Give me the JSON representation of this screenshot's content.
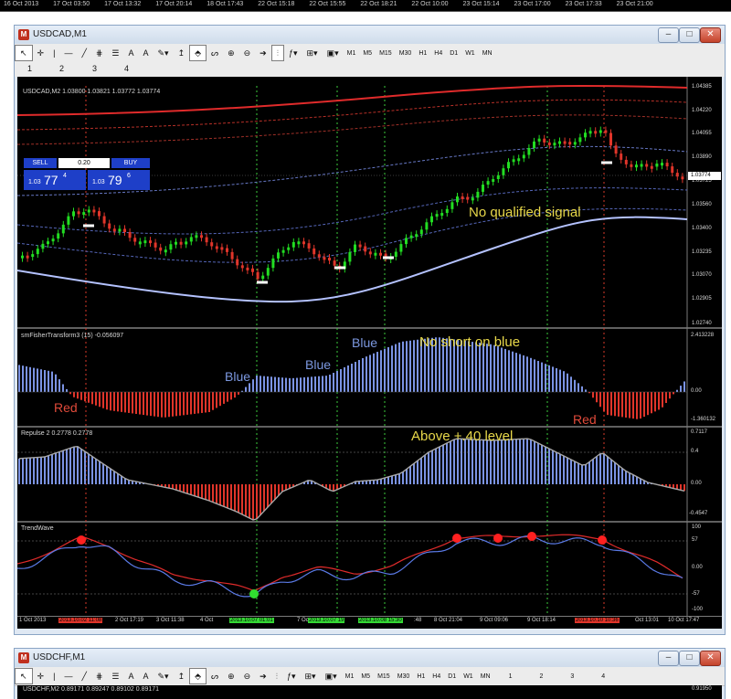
{
  "top_strip": {
    "time_labels": [
      "16 Oct 2013",
      "17 Oct 03:50",
      "17 Oct 13:32",
      "17 Oct 20:14",
      "18 Oct 17:43",
      "22 Oct 15:18",
      "22 Oct 15:55",
      "22 Oct 18:21",
      "22 Oct 10:00",
      "23 Oct 15:14",
      "23 Oct 17:00",
      "23 Oct 17:33",
      "23 Oct 21:00"
    ]
  },
  "windows": [
    {
      "title": "USDCAD,M1",
      "controls": {
        "minimize": "–",
        "maximize": "□",
        "close": "✕"
      },
      "toolbar_letters": [
        "A",
        "A"
      ],
      "timeframes": [
        "M1",
        "M5",
        "M15",
        "M30",
        "H1",
        "H4",
        "D1",
        "W1",
        "MN"
      ],
      "chart_numbers": [
        "1",
        "2",
        "3",
        "4"
      ]
    },
    {
      "title": "USDCHF,M1",
      "controls": {
        "minimize": "–",
        "maximize": "□",
        "close": "✕"
      },
      "toolbar_letters": [
        "A",
        "A"
      ],
      "timeframes": [
        "M1",
        "M5",
        "M15",
        "M30",
        "H1",
        "H4",
        "D1",
        "W1",
        "MN"
      ],
      "chart_numbers": [
        "1",
        "2",
        "3",
        "4"
      ]
    }
  ],
  "usdcad_chart": {
    "header": "USDCAD,M2  1.03800 1.03821 1.03772 1.03774",
    "trade_panel": {
      "sell": "SELL",
      "buy": "BUY",
      "lot": "0.20",
      "bid_big": "1.03",
      "bid_main": "77",
      "bid_sup": "4",
      "ask_big": "1.03",
      "ask_main": "79",
      "ask_sup": "6"
    },
    "price_axis": [
      "1.04385",
      "1.04220",
      "1.04055",
      "1.03890",
      "1.03725",
      "1.03560",
      "1.03400",
      "1.03235",
      "1.03070",
      "1.02905",
      "1.02740"
    ],
    "current_price": "1.03774",
    "annotation": "No qualified signal"
  },
  "fisher_panel": {
    "label": "smFisherTransform3 (15) -0.056097",
    "axis": [
      "2.413228",
      "0.00",
      "-1.360132"
    ],
    "annotations": [
      "Blue",
      "Blue",
      "Blue",
      "No short on blue",
      "Red",
      "Red"
    ]
  },
  "repulse_panel": {
    "label": "Repulse 2 0.2778 0.2778",
    "axis": [
      "0.7117",
      "0.4",
      "0.00",
      "-0.4547"
    ],
    "annotation": "Above +.40 level"
  },
  "trendwave_panel": {
    "label": "TrendWave",
    "axis": [
      "100",
      "57",
      "0.00",
      "-57",
      "-100"
    ]
  },
  "time_axis": {
    "labels": [
      "1 Oct 2013",
      "2013.10.02 11:08",
      "2 Oct 17:19",
      "3 Oct 11:38",
      "4 Oct",
      "2013.10.07 01:01",
      "7 Oct",
      "2013.10.07 19",
      "2013.10.08 15:30",
      ":48",
      "8 Oct 21:04",
      "9 Oct 09:06",
      "9 Oct 18:14",
      "2013.10.10 10:36",
      "Oct 13:01",
      "10 Oct 17:47"
    ]
  },
  "usdchf_chart": {
    "header": "USDCHF,M2  0.89171 0.89247 0.89102 0.89171",
    "price_top": "0.91950"
  },
  "colors": {
    "bull": "#22dd22",
    "bear": "#e0352a",
    "indicator_blue": "#7b93e3",
    "annotation": "#e8d84a"
  }
}
